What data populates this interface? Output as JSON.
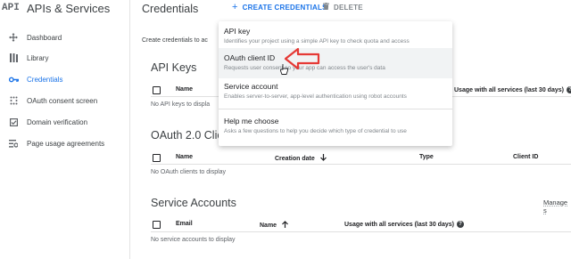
{
  "sidebar": {
    "api_badge": "API",
    "title": "APIs & Services",
    "items": [
      {
        "label": "Dashboard",
        "icon": "dashboard-icon"
      },
      {
        "label": "Library",
        "icon": "library-icon"
      },
      {
        "label": "Credentials",
        "icon": "key-icon",
        "active": true
      },
      {
        "label": "OAuth consent screen",
        "icon": "consent-icon"
      },
      {
        "label": "Domain verification",
        "icon": "check-box-icon"
      },
      {
        "label": "Page usage agreements",
        "icon": "settings-list-icon"
      }
    ]
  },
  "header": {
    "title": "Credentials",
    "create_label": "CREATE CREDENTIALS",
    "delete_label": "DELETE"
  },
  "main": {
    "intro": "Create credentials to ac",
    "api_keys": {
      "title": "API Keys",
      "col_name": "Name",
      "col_usage": "Usage with all services (last 30 days)",
      "empty": "No API keys to displa"
    },
    "oauth": {
      "title": "OAuth 2.0 Clie",
      "col_name": "Name",
      "col_created": "Creation date",
      "col_type": "Type",
      "col_client": "Client ID",
      "empty": "No OAuth clients to display"
    },
    "service_accounts": {
      "title": "Service Accounts",
      "manage": "Manage s",
      "col_email": "Email",
      "col_name": "Name",
      "col_usage": "Usage with all services (last 30 days)",
      "empty": "No service accounts to display"
    }
  },
  "dropdown": {
    "items": [
      {
        "title": "API key",
        "desc": "Identifies your project using a simple API key to check quota and access"
      },
      {
        "title": "OAuth client ID",
        "desc": "Requests user consent so your app can access the user's data"
      },
      {
        "title": "Service account",
        "desc": "Enables server-to-server, app-level authentication using robot accounts"
      },
      {
        "title": "Help me choose",
        "desc": "Asks a few questions to help you decide which type of credential to use"
      }
    ]
  },
  "colors": {
    "accent": "#1a73e8",
    "annotation": "#e53935"
  }
}
